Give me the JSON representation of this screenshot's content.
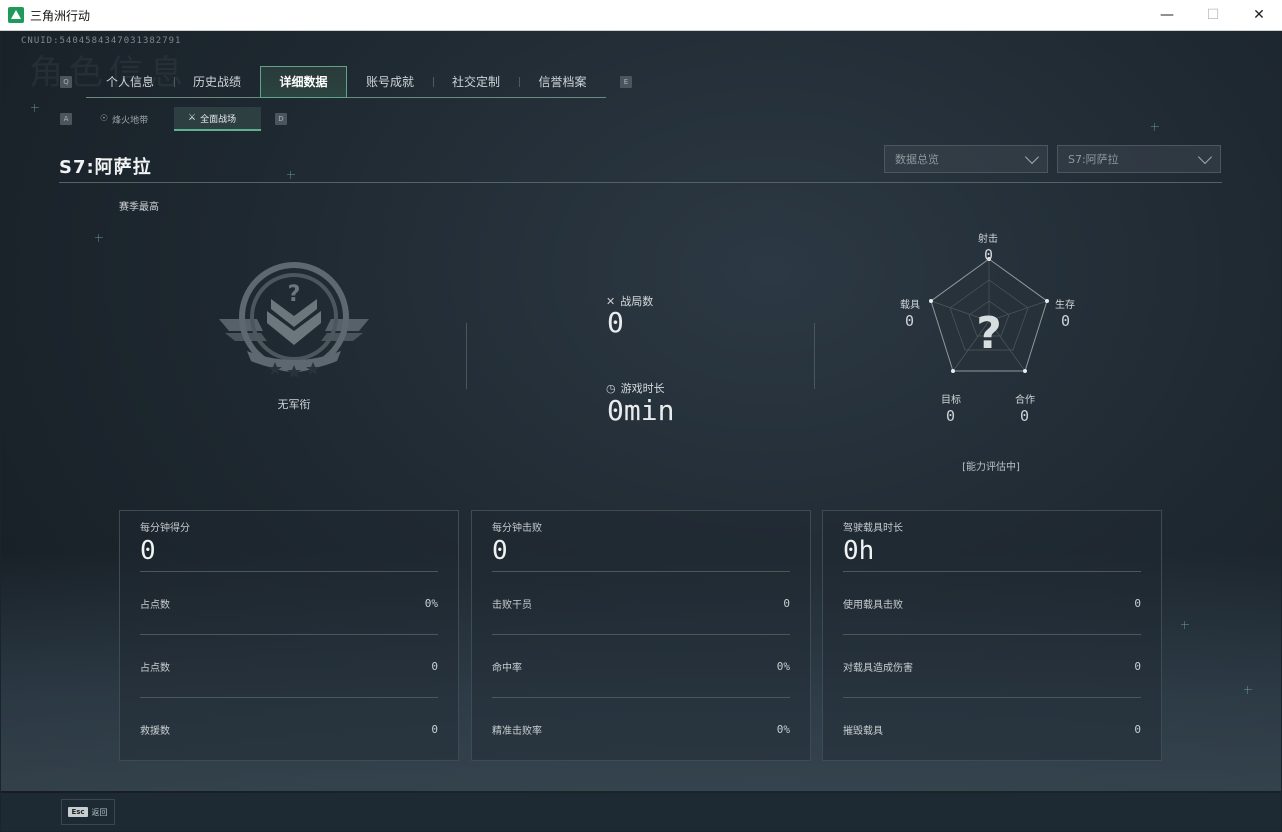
{
  "window": {
    "title": "三角洲行动",
    "minimize": "—",
    "maximize": "☐",
    "close": "✕"
  },
  "header": {
    "cnuid": "CNUID:5404584347031382791",
    "ghost_title": "角色信息"
  },
  "tabs": {
    "left_key": "Q",
    "right_key": "E",
    "items": [
      {
        "label": "个人信息"
      },
      {
        "label": "历史战绩"
      },
      {
        "label": "详细数据"
      },
      {
        "label": "账号成就"
      },
      {
        "label": "社交定制"
      },
      {
        "label": "信誉档案"
      }
    ]
  },
  "subtabs": {
    "left_key": "A",
    "right_key": "D",
    "items": [
      {
        "label": "烽火地带",
        "icon": "☉"
      },
      {
        "label": "全面战场",
        "icon": "⚔"
      }
    ]
  },
  "season": {
    "title": "S7:阿萨拉",
    "best_label": "赛季最高",
    "rank_name": "无军衔",
    "dropdown_view": "数据总览",
    "dropdown_season": "S7:阿萨拉"
  },
  "summary": {
    "matches_label": "战局数",
    "matches_value": "0",
    "playtime_label": "游戏时长",
    "playtime_value": "0min"
  },
  "radar": {
    "center_mark": "?",
    "status": "[能力评估中]",
    "axes": [
      {
        "label": "射击",
        "value": "0"
      },
      {
        "label": "生存",
        "value": "0"
      },
      {
        "label": "合作",
        "value": "0"
      },
      {
        "label": "目标",
        "value": "0"
      },
      {
        "label": "载具",
        "value": "0"
      }
    ]
  },
  "cards": [
    {
      "title": "每分钟得分",
      "value": "0",
      "rows": [
        {
          "label": "占点数",
          "value": "0%"
        },
        {
          "label": "占点数",
          "value": "0"
        },
        {
          "label": "救援数",
          "value": "0"
        }
      ]
    },
    {
      "title": "每分钟击败",
      "value": "0",
      "rows": [
        {
          "label": "击败干员",
          "value": "0"
        },
        {
          "label": "命中率",
          "value": "0%"
        },
        {
          "label": "精准击败率",
          "value": "0%"
        }
      ]
    },
    {
      "title": "驾驶载具时长",
      "value": "0h",
      "rows": [
        {
          "label": "使用载具击败",
          "value": "0"
        },
        {
          "label": "对载具造成伤害",
          "value": "0"
        },
        {
          "label": "摧毁载具",
          "value": "0"
        }
      ]
    }
  ],
  "footer": {
    "esc_key": "Esc",
    "back_label": "返回"
  },
  "colors": {
    "accent": "#5fb08c",
    "background": "#1b242c"
  }
}
